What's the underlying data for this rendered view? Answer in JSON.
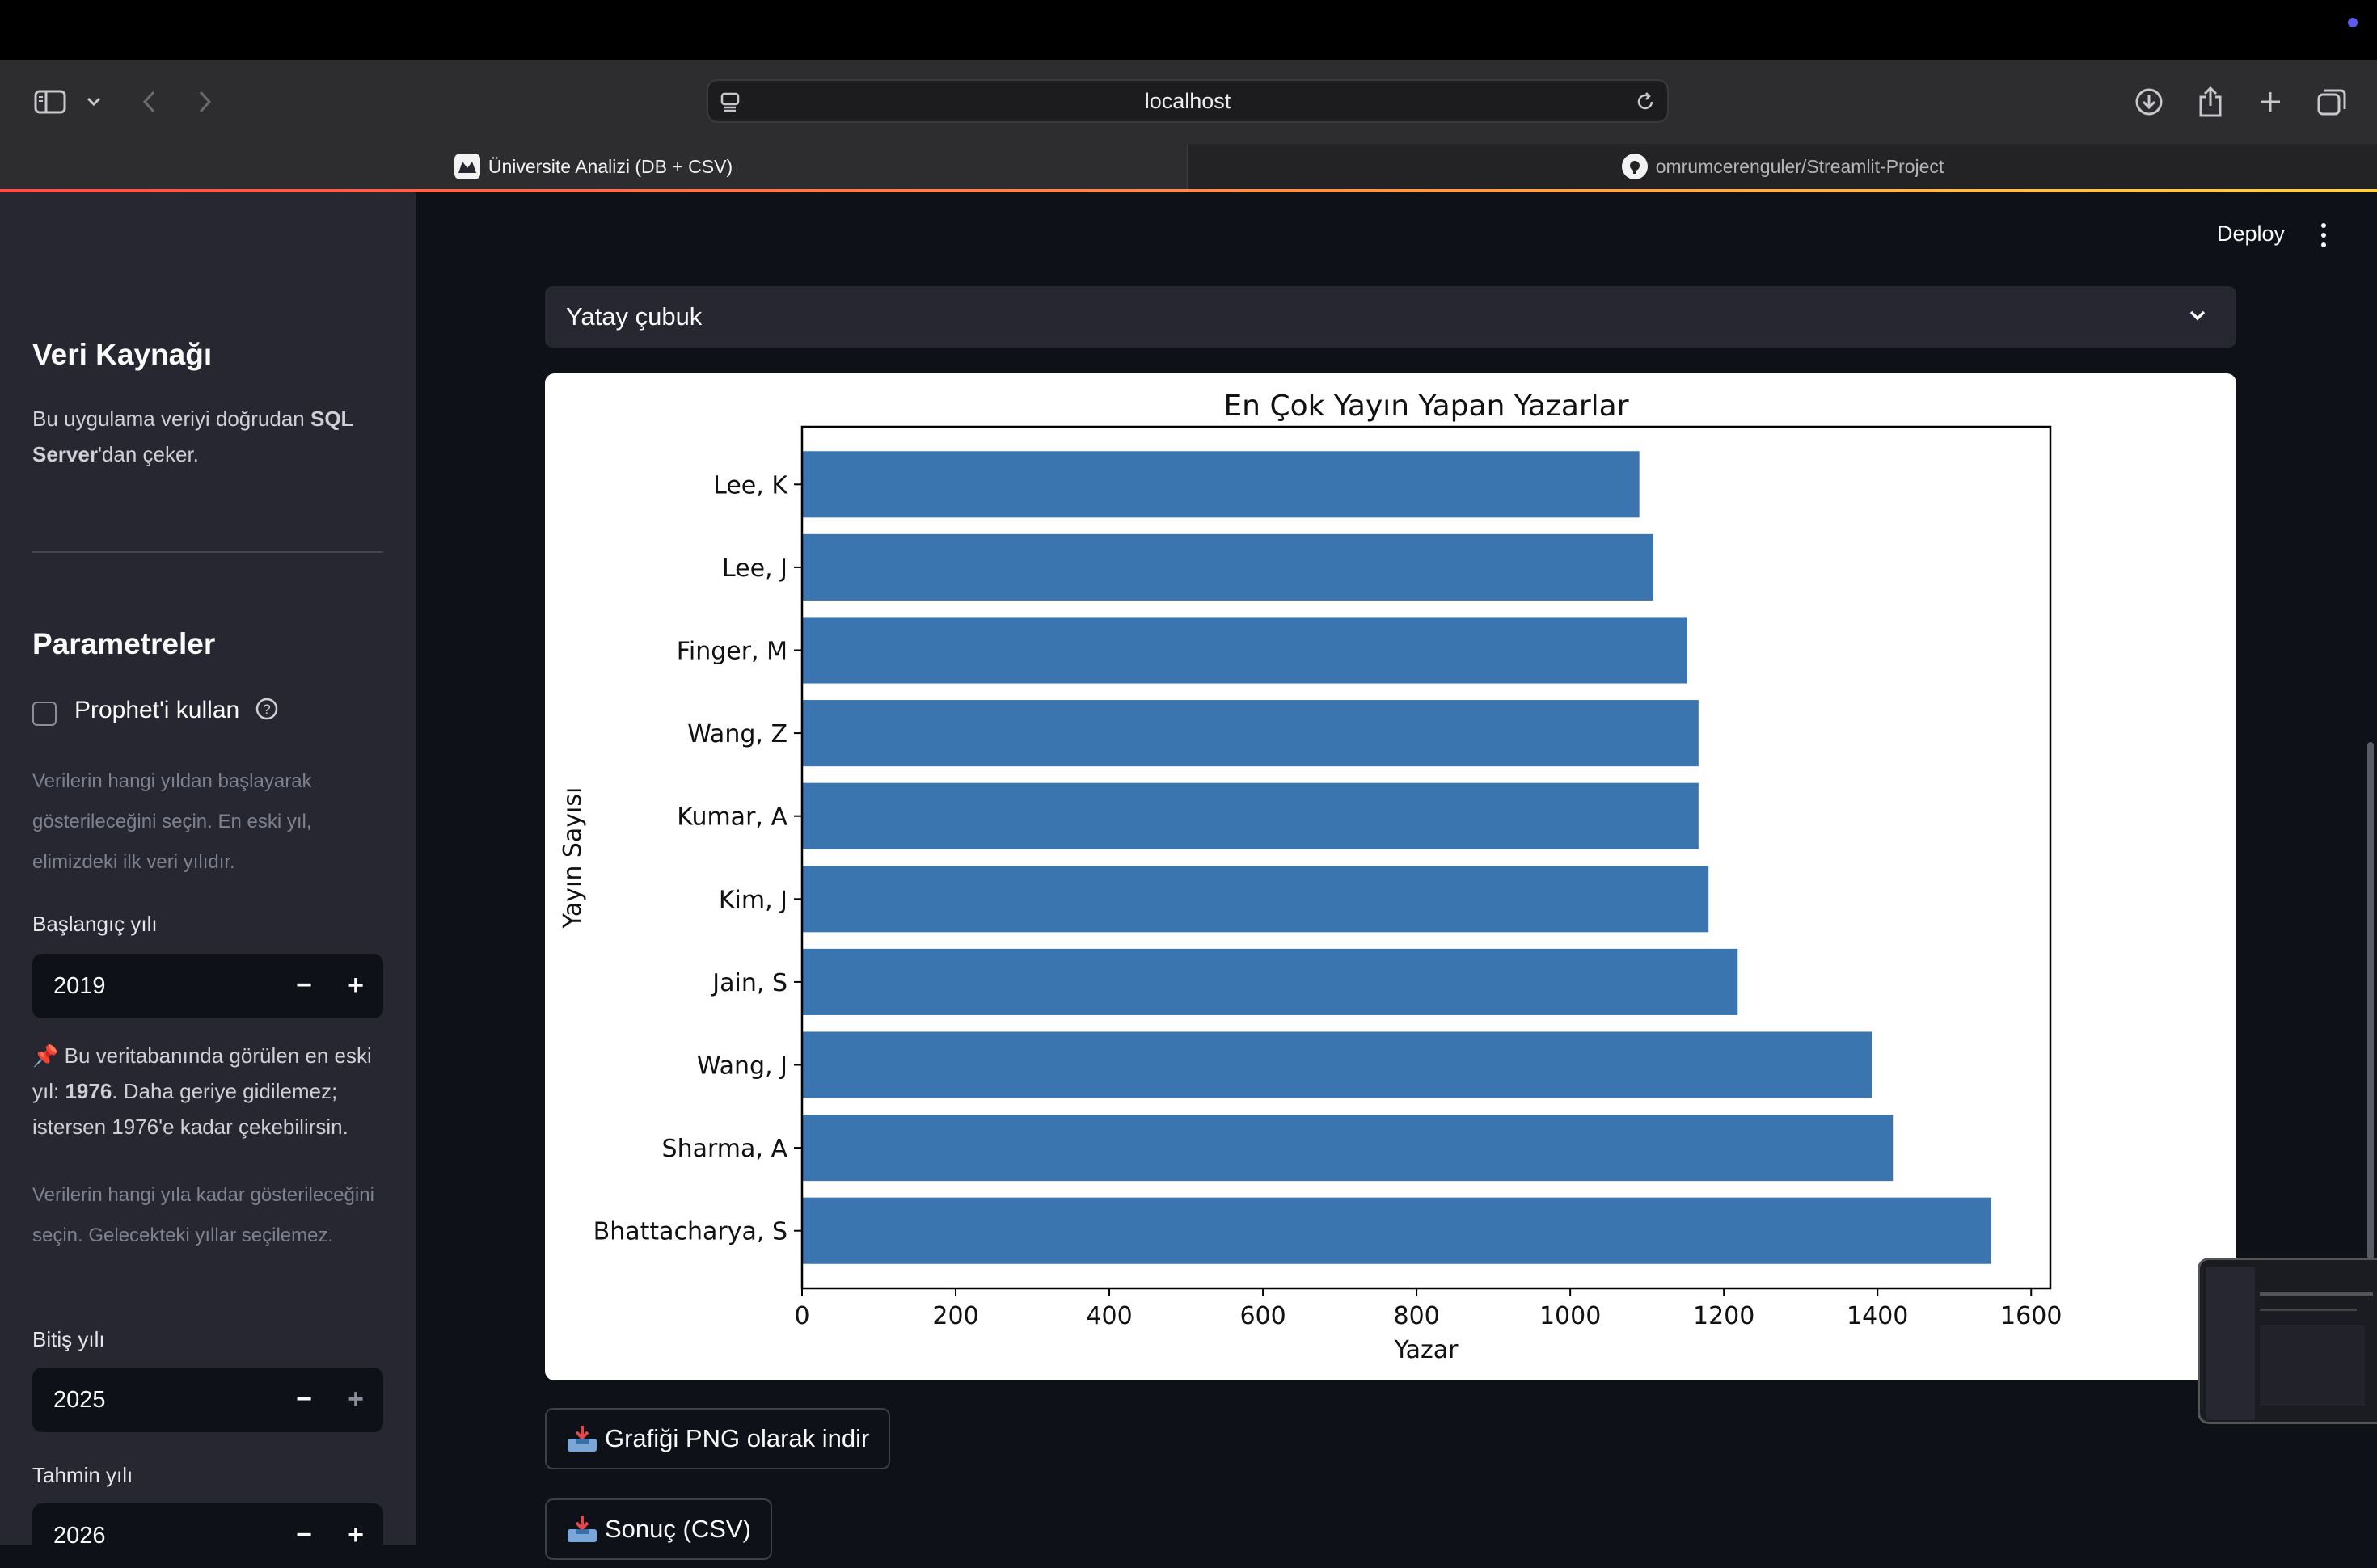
{
  "browser": {
    "url": "localhost",
    "tabs": [
      {
        "title": "Üniversite Analizi (DB + CSV)",
        "active": true
      },
      {
        "title": "omrumcerenguler/Streamlit-Project",
        "active": false
      }
    ]
  },
  "header": {
    "deploy_label": "Deploy"
  },
  "sidebar": {
    "source_title": "Veri Kaynağı",
    "source_text_a": "Bu uygulama veriyi doğrudan ",
    "source_text_b": "SQL Server",
    "source_text_c": "'dan çeker.",
    "params_title": "Parametreler",
    "prophet_label": "Prophet'i kullan",
    "start_help": "Verilerin hangi yıldan başlayarak gösterileceğini seçin. En eski yıl, elimizdeki ilk veri yılıdır.",
    "start_label": "Başlangıç yılı",
    "start_value": "2019",
    "note_a": "Bu veritabanında görülen en eski yıl: ",
    "note_b": "1976",
    "note_c": ". Daha geriye gidilemez; istersen 1976'e kadar çekebilirsin.",
    "end_help": "Verilerin hangi yıla kadar gösterileceğini seçin. Gelecekteki yıllar seçilemez.",
    "end_label": "Bitiş yılı",
    "end_value": "2025",
    "forecast_label": "Tahmin yılı",
    "forecast_value": "2026",
    "minus": "−",
    "plus": "+"
  },
  "main": {
    "chart_type_selected": "Yatay çubuk",
    "download_png_label": "Grafiği PNG olarak indir",
    "download_csv_label": "Sonuç (CSV)"
  },
  "colors": {
    "bar": "#3a75b0",
    "accent": "#ff4b4b"
  },
  "chart_data": {
    "type": "bar",
    "orientation": "horizontal",
    "title": "En Çok Yayın Yapan Yazarlar",
    "xlabel": "Yazar",
    "ylabel": "Yayın Sayısı",
    "categories": [
      "Lee, K",
      "Lee, J",
      "Finger, M",
      "Wang, Z",
      "Kumar, A",
      "Kim, J",
      "Jain, S",
      "Wang, J",
      "Sharma, A",
      "Bhattacharya, S"
    ],
    "values": [
      1090,
      1108,
      1152,
      1167,
      1167,
      1180,
      1218,
      1393,
      1420,
      1548
    ],
    "xlim": [
      0,
      1625
    ],
    "xticks": [
      0,
      200,
      400,
      600,
      800,
      1000,
      1200,
      1400,
      1600
    ],
    "grid": false
  }
}
